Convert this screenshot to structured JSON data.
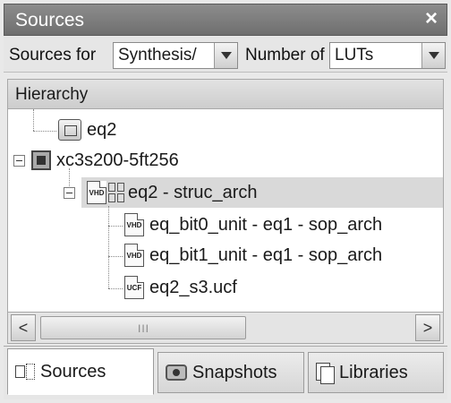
{
  "window": {
    "title": "Sources",
    "close_glyph": "×"
  },
  "filters": {
    "sources_for_label": "Sources for",
    "sources_for_value": "Synthesis/",
    "number_of_label": "Number of",
    "number_of_value": "LUTs"
  },
  "hierarchy": {
    "header": "Hierarchy",
    "nodes": [
      {
        "label": "eq2",
        "icon": "schematic-icon"
      },
      {
        "label": "xc3s200-5ft256",
        "icon": "chip-icon"
      },
      {
        "label": "eq2 - struc_arch",
        "icon": "vhdl-file-icon"
      },
      {
        "label": "eq_bit0_unit - eq1 - sop_arch",
        "icon": "vhdl-file-icon"
      },
      {
        "label": "eq_bit1_unit - eq1 - sop_arch",
        "icon": "vhdl-file-icon"
      },
      {
        "label": "eq2_s3.ucf",
        "icon": "ucf-file-icon"
      }
    ],
    "file_badges": {
      "vhdl": "VHD",
      "ucf": "UCF"
    }
  },
  "scrollbar": {
    "left_glyph": "<",
    "right_glyph": ">",
    "grip": "III"
  },
  "tabs": [
    {
      "label": "Sources",
      "active": true
    },
    {
      "label": "Snapshots",
      "active": false
    },
    {
      "label": "Libraries",
      "active": false
    }
  ],
  "colors": {
    "titlebar": "#7d7d7d",
    "selection": "#d9d9d9",
    "panel": "#e9e9e9"
  }
}
